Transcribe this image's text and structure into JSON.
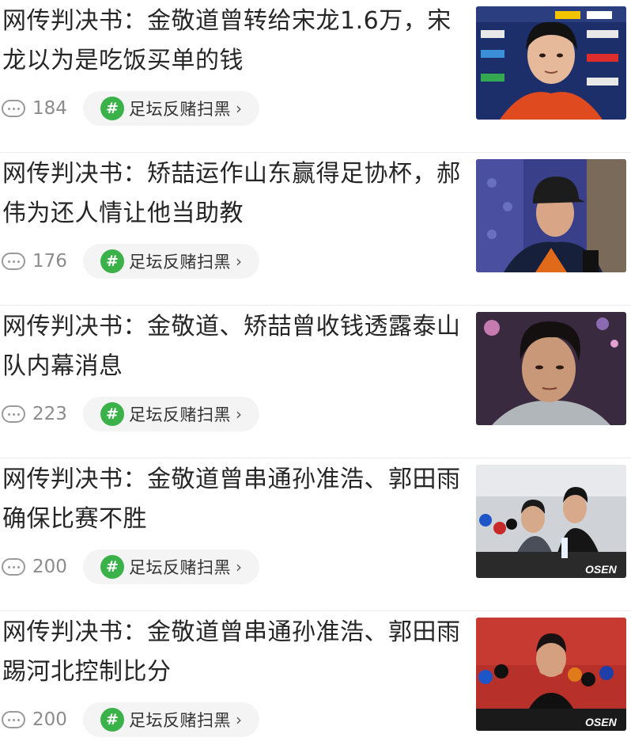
{
  "feed": {
    "items": [
      {
        "title": "网传判决书：金敬道曾转给宋龙1.6万，宋龙以为是吃饭买单的钱",
        "comments": "184",
        "tag": "足坛反赌扫黑"
      },
      {
        "title": "网传判决书：矫喆运作山东赢得足协杯，郝伟为还人情让他当助教",
        "comments": "176",
        "tag": "足坛反赌扫黑"
      },
      {
        "title": "网传判决书：金敬道、矫喆曾收钱透露泰山队内幕消息",
        "comments": "223",
        "tag": "足坛反赌扫黑"
      },
      {
        "title": "网传判决书：金敬道曾串通孙准浩、郭田雨确保比赛不胜",
        "comments": "200",
        "tag": "足坛反赌扫黑"
      },
      {
        "title": "网传判决书：金敬道曾串通孙准浩、郭田雨踢河北控制比分",
        "comments": "200",
        "tag": "足坛反赌扫黑"
      }
    ],
    "tag_symbol": "#",
    "chevron": "›",
    "thumb_watermark": "OSEN",
    "accent_color": "#3bb14a"
  }
}
